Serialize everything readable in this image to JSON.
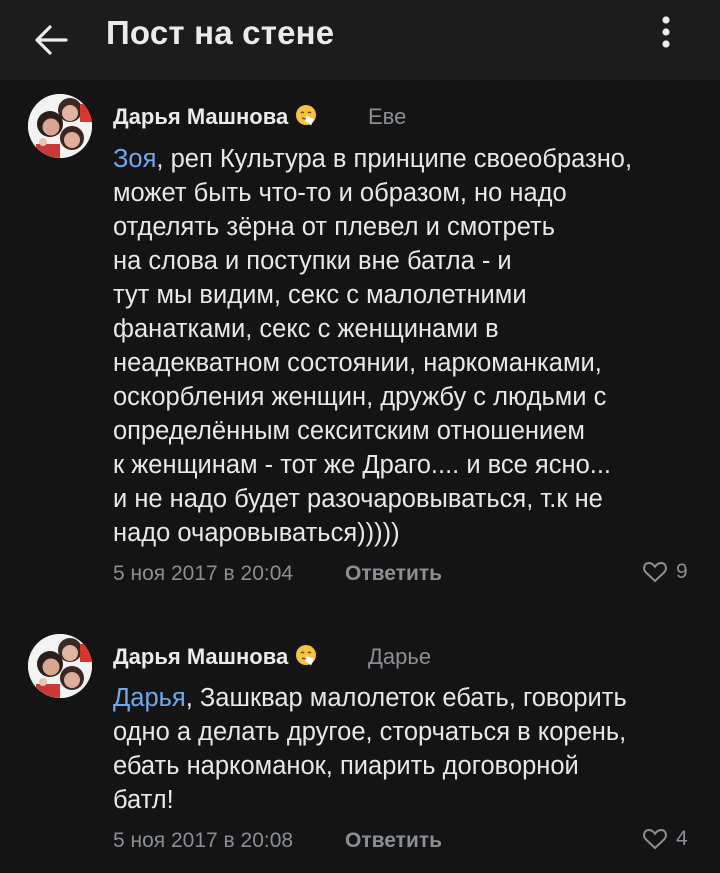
{
  "header": {
    "title": "Пост на стене"
  },
  "comments": [
    {
      "author": "Дарья Машнова",
      "reply_to": "Еве",
      "mention": "Зоя",
      "text_lines": [
        ", реп Культура в принципе своеобразно,",
        "может быть что-то и образом, но надо",
        "отделять зёрна от плевел и смотреть",
        "на слова и поступки вне батла - и",
        "тут мы видим, секс с малолетними",
        "фанатками, секс с женщинами в",
        "неадекватном состоянии, наркоманками,",
        "оскорбления женщин, дружбу с людьми с",
        "определённым секситским отношением",
        "к женщинам - тот же Драго.... и все ясно...",
        "и не надо будет разочаровываться, т.к не",
        "надо очаровываться)))))"
      ],
      "date": "5 ноя 2017 в 20:04",
      "reply_label": "Ответить",
      "likes": "9"
    },
    {
      "author": "Дарья Машнова",
      "reply_to": "Дарье",
      "mention": "Дарья",
      "text_lines": [
        ", Зашквар малолеток ебать, говорить",
        "одно а делать другое, сторчаться в корень,",
        "ебать наркоманок, пиарить договорной",
        "батл!"
      ],
      "date": "5 ноя 2017 в 20:08",
      "reply_label": "Ответить",
      "likes": "4"
    }
  ],
  "icons": {
    "back": "arrow-left-icon",
    "more": "more-vertical-icon",
    "like": "heart-outline-icon",
    "emoji": "sneezing-face-emoji"
  },
  "colors": {
    "background": "#141414",
    "header_bg": "#1c1c1c",
    "link": "#71aaeb",
    "secondary_text": "#8a8f96"
  }
}
